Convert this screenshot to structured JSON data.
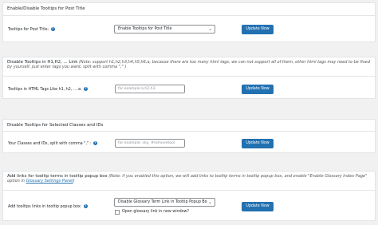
{
  "sections": [
    {
      "title": "Enable/Disable Tooltips for Post Title",
      "note": "",
      "row_label": "Tooltips for Post Title:",
      "control_type": "select",
      "control_value": "Enable Tooltips for Post Title",
      "button_label": "Update Now"
    },
    {
      "title": "Disable Tooltips in H1,H2, ... Link",
      "note": "(Note: support h1,h2,h3,h4,h5,h6,a, because there are too many html tags, we can not support all of them, other html tags may need to be fixed by yourself, just enter tags you want, split with comma \",\" )",
      "row_label": "Tooltips in HTML Tags Like h1, h2, ... a:",
      "control_type": "input",
      "control_placeholder": "for example:a,h2,h3",
      "button_label": "Update Now"
    },
    {
      "title": "Disable Tooltips for Selected Classes and IDs",
      "note": "",
      "row_label": "Your Classes and IDs, split with comma \",\" :",
      "control_type": "input",
      "control_placeholder": "for example: sky, #removetool",
      "button_label": "Update Now"
    },
    {
      "title": "Add links for tooltip terms in tooltip popup box",
      "note_before_link": "(Note: if you enabled this option, we will add links to tooltip terms in tooltip popup box, and enable \"Enable Glossary Index Page\" option in",
      "note_link": "Glossary Settings Panel",
      "note_after_link": ")",
      "row_label": "Add tooltips links in tooltip popup box:",
      "control_type": "select",
      "control_value": "Disable Glossary Term Link in Tooltip Popup Box",
      "checkbox_label": "Open glossary link in new window?",
      "checkbox_checked": false,
      "button_label": "Update Now"
    }
  ],
  "icons": {
    "help": "question-circle-icon",
    "dropdown": "chevron-down-icon"
  },
  "colors": {
    "accent": "#2271b1",
    "background": "#f1f1f1",
    "panel": "#ffffff"
  }
}
